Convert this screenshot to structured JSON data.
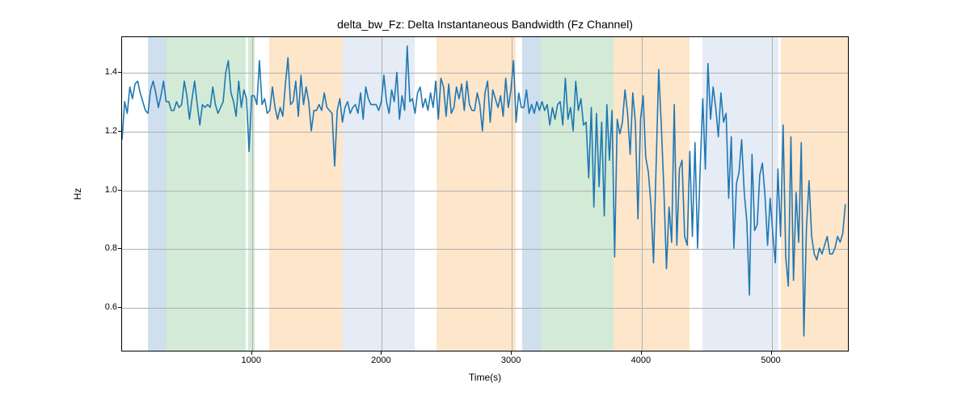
{
  "chart_data": {
    "type": "line",
    "title": "delta_bw_Fz: Delta Instantaneous Bandwidth (Fz Channel)",
    "xlabel": "Time(s)",
    "ylabel": "Hz",
    "xlim": [
      0,
      5600
    ],
    "ylim": [
      0.45,
      1.52
    ],
    "xticks": [
      1000,
      2000,
      3000,
      4000,
      5000
    ],
    "yticks": [
      0.6,
      0.8,
      1.0,
      1.2,
      1.4
    ],
    "bands": [
      {
        "x0": 200,
        "x1": 340,
        "color": "blue"
      },
      {
        "x0": 340,
        "x1": 950,
        "color": "green"
      },
      {
        "x0": 970,
        "x1": 1020,
        "color": "green"
      },
      {
        "x0": 1130,
        "x1": 1700,
        "color": "orange"
      },
      {
        "x0": 1700,
        "x1": 2250,
        "color": "lightblue"
      },
      {
        "x0": 2420,
        "x1": 3030,
        "color": "orange"
      },
      {
        "x0": 3080,
        "x1": 3220,
        "color": "blue"
      },
      {
        "x0": 3220,
        "x1": 3780,
        "color": "green"
      },
      {
        "x0": 3780,
        "x1": 4370,
        "color": "orange"
      },
      {
        "x0": 4470,
        "x1": 5050,
        "color": "lightblue"
      },
      {
        "x0": 5070,
        "x1": 5600,
        "color": "orange"
      }
    ],
    "series": [
      {
        "name": "delta_bw_Fz",
        "x": [
          0,
          20,
          40,
          60,
          80,
          100,
          120,
          140,
          160,
          180,
          200,
          220,
          240,
          260,
          280,
          300,
          320,
          340,
          360,
          380,
          400,
          420,
          440,
          460,
          480,
          500,
          520,
          540,
          560,
          580,
          600,
          620,
          640,
          660,
          680,
          700,
          720,
          740,
          760,
          780,
          800,
          820,
          840,
          860,
          880,
          900,
          920,
          940,
          960,
          980,
          1000,
          1020,
          1040,
          1060,
          1080,
          1100,
          1120,
          1140,
          1160,
          1180,
          1200,
          1220,
          1240,
          1260,
          1280,
          1300,
          1320,
          1340,
          1360,
          1380,
          1400,
          1420,
          1440,
          1460,
          1480,
          1500,
          1520,
          1540,
          1560,
          1580,
          1600,
          1620,
          1640,
          1660,
          1680,
          1700,
          1720,
          1740,
          1760,
          1780,
          1800,
          1820,
          1840,
          1860,
          1880,
          1900,
          1920,
          1940,
          1960,
          1980,
          2000,
          2020,
          2040,
          2060,
          2080,
          2100,
          2120,
          2140,
          2160,
          2180,
          2200,
          2220,
          2240,
          2260,
          2280,
          2300,
          2320,
          2340,
          2360,
          2380,
          2400,
          2420,
          2440,
          2460,
          2480,
          2500,
          2520,
          2540,
          2560,
          2580,
          2600,
          2620,
          2640,
          2660,
          2680,
          2700,
          2720,
          2740,
          2760,
          2780,
          2800,
          2820,
          2840,
          2860,
          2880,
          2900,
          2920,
          2940,
          2960,
          2980,
          3000,
          3020,
          3040,
          3060,
          3080,
          3100,
          3120,
          3140,
          3160,
          3180,
          3200,
          3220,
          3240,
          3260,
          3280,
          3300,
          3320,
          3340,
          3360,
          3380,
          3400,
          3420,
          3440,
          3460,
          3480,
          3500,
          3520,
          3540,
          3560,
          3580,
          3600,
          3620,
          3640,
          3660,
          3680,
          3700,
          3720,
          3740,
          3760,
          3780,
          3800,
          3820,
          3840,
          3860,
          3880,
          3900,
          3920,
          3940,
          3960,
          3980,
          4000,
          4020,
          4040,
          4060,
          4080,
          4100,
          4120,
          4140,
          4160,
          4180,
          4200,
          4220,
          4240,
          4260,
          4280,
          4300,
          4320,
          4340,
          4360,
          4380,
          4400,
          4420,
          4440,
          4460,
          4480,
          4500,
          4520,
          4540,
          4560,
          4580,
          4600,
          4620,
          4640,
          4660,
          4680,
          4700,
          4720,
          4740,
          4760,
          4780,
          4800,
          4820,
          4840,
          4860,
          4880,
          4900,
          4920,
          4940,
          4960,
          4980,
          5000,
          5020,
          5040,
          5060,
          5080,
          5100,
          5120,
          5140,
          5160,
          5180,
          5200,
          5220,
          5240,
          5260,
          5280,
          5300,
          5320,
          5340,
          5360,
          5380,
          5400,
          5420,
          5440,
          5460,
          5480,
          5500,
          5520,
          5540,
          5560,
          5580
        ],
        "y": [
          1.17,
          1.3,
          1.26,
          1.35,
          1.31,
          1.36,
          1.37,
          1.33,
          1.3,
          1.27,
          1.26,
          1.34,
          1.37,
          1.33,
          1.28,
          1.32,
          1.37,
          1.3,
          1.3,
          1.27,
          1.27,
          1.3,
          1.28,
          1.29,
          1.37,
          1.32,
          1.24,
          1.31,
          1.37,
          1.29,
          1.22,
          1.29,
          1.28,
          1.29,
          1.28,
          1.35,
          1.29,
          1.26,
          1.28,
          1.3,
          1.4,
          1.44,
          1.33,
          1.3,
          1.25,
          1.37,
          1.28,
          1.34,
          1.31,
          1.13,
          1.32,
          1.32,
          1.29,
          1.44,
          1.29,
          1.31,
          1.26,
          1.27,
          1.35,
          1.28,
          1.24,
          1.28,
          1.25,
          1.36,
          1.45,
          1.29,
          1.3,
          1.37,
          1.25,
          1.39,
          1.29,
          1.35,
          1.3,
          1.2,
          1.27,
          1.27,
          1.29,
          1.27,
          1.33,
          1.28,
          1.27,
          1.26,
          1.08,
          1.27,
          1.31,
          1.23,
          1.28,
          1.3,
          1.26,
          1.28,
          1.29,
          1.26,
          1.33,
          1.24,
          1.35,
          1.31,
          1.29,
          1.29,
          1.29,
          1.27,
          1.3,
          1.39,
          1.3,
          1.26,
          1.34,
          1.3,
          1.4,
          1.24,
          1.32,
          1.27,
          1.49,
          1.3,
          1.31,
          1.26,
          1.33,
          1.35,
          1.28,
          1.31,
          1.27,
          1.33,
          1.28,
          1.37,
          1.24,
          1.38,
          1.35,
          1.25,
          1.36,
          1.26,
          1.28,
          1.35,
          1.31,
          1.36,
          1.27,
          1.37,
          1.29,
          1.27,
          1.27,
          1.33,
          1.29,
          1.2,
          1.33,
          1.37,
          1.23,
          1.34,
          1.31,
          1.28,
          1.32,
          1.25,
          1.38,
          1.28,
          1.34,
          1.44,
          1.23,
          1.33,
          1.28,
          1.28,
          1.34,
          1.26,
          1.29,
          1.26,
          1.3,
          1.27,
          1.3,
          1.27,
          1.29,
          1.22,
          1.28,
          1.24,
          1.29,
          1.3,
          1.22,
          1.38,
          1.24,
          1.28,
          1.2,
          1.37,
          1.27,
          1.31,
          1.22,
          1.23,
          1.04,
          1.28,
          0.94,
          1.26,
          1.01,
          1.23,
          0.91,
          1.29,
          1.1,
          1.27,
          0.77,
          1.24,
          1.19,
          1.23,
          1.34,
          1.26,
          1.12,
          1.33,
          1.23,
          0.9,
          1.24,
          1.32,
          1.11,
          1.06,
          0.95,
          0.75,
          1.08,
          1.41,
          1.22,
          1.0,
          0.73,
          0.94,
          0.82,
          1.29,
          0.81,
          1.07,
          1.1,
          0.84,
          0.81,
          1.13,
          0.84,
          1.16,
          0.8,
          1.07,
          1.31,
          1.07,
          1.43,
          1.24,
          1.35,
          1.28,
          1.18,
          1.33,
          1.23,
          1.26,
          0.97,
          1.18,
          0.8,
          1.02,
          1.06,
          1.17,
          0.99,
          0.89,
          0.64,
          1.12,
          0.86,
          0.88,
          1.05,
          1.09,
          0.98,
          0.81,
          0.97,
          0.85,
          0.75,
          1.07,
          0.84,
          1.22,
          0.77,
          0.67,
          1.18,
          0.69,
          0.99,
          0.82,
          1.16,
          0.5,
          0.87,
          1.03,
          0.84,
          0.78,
          0.76,
          0.8,
          0.78,
          0.81,
          0.84,
          0.78,
          0.78,
          0.8,
          0.84,
          0.82,
          0.85,
          0.95
        ]
      }
    ]
  }
}
